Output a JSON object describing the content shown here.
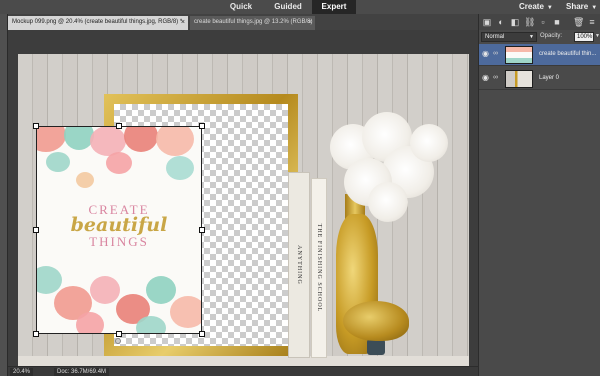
{
  "modes": {
    "quick": "Quick",
    "guided": "Guided",
    "expert": "Expert"
  },
  "topright": {
    "create": "Create",
    "share": "Share"
  },
  "tabs": [
    {
      "label": "Mockup 099.png @ 20.4% (create beautiful things.jpg, RGB/8) *",
      "close": "×"
    },
    {
      "label": "create beautiful things.jpg @ 13.2% (RGB/8)",
      "close": "×"
    }
  ],
  "poster": {
    "line1": "CREATE",
    "line2": "beautiful",
    "line3": "THINGS"
  },
  "books": [
    {
      "spine": "ANYTHING"
    },
    {
      "spine": "THE FINISHING SCHOOL"
    }
  ],
  "status": {
    "zoom": "20.4%",
    "doc": "Doc: 36.7M/69.4M"
  },
  "layers_panel": {
    "blend_mode": "Normal",
    "opacity_label": "Opacity:",
    "opacity_value": "100%",
    "layers": [
      {
        "name": "create beautiful thin...",
        "selected": true
      },
      {
        "name": "Layer 0",
        "selected": false
      }
    ]
  },
  "colors": {
    "accent_selected_layer": "#4d6a9c",
    "frame_gold": "#c79b25",
    "poster_title_gold": "#c9a646",
    "poster_title_pink": "#d985a0"
  }
}
